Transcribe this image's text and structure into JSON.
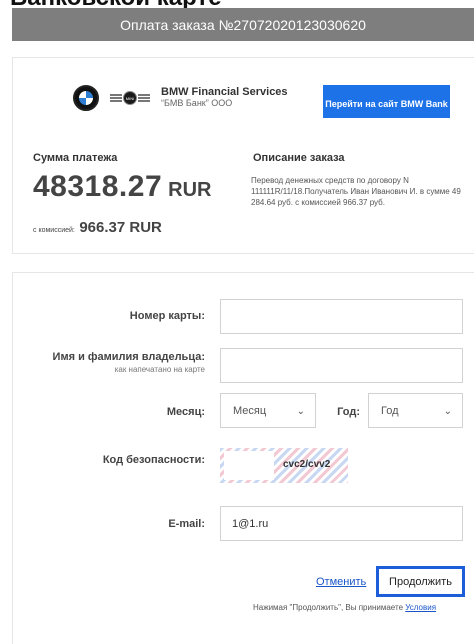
{
  "page": {
    "heading": "Банковской карте"
  },
  "order": {
    "title": "Оплата заказа №27072020123030620"
  },
  "merchant": {
    "logos": {
      "bmw": "bmw-logo",
      "mini": "mini-logo",
      "mini_text": "MINI"
    },
    "name": "BMW Financial Services",
    "subtitle": "“БМВ Банк” ООО",
    "site_button": "Перейти на сайт BMW Bank"
  },
  "payment": {
    "sum_label": "Сумма платежа",
    "amount": "48318.27",
    "currency": "RUR",
    "commission_label": "с комиссией:",
    "commission_value": "966.37 RUR"
  },
  "description": {
    "label": "Описание заказа",
    "text": "Перевод денежных средств по договору N 111111R/11/18.Получатель Иван Иванович И. в сумме 49 284.64 руб. с комиссией 966.37 руб."
  },
  "form": {
    "card_number_label": "Номер карты:",
    "card_number_value": "",
    "holder_label": "Имя и фамилия владельца:",
    "holder_hint": "как напечатано на карте",
    "holder_value": "",
    "month_label": "Месяц:",
    "month_value": "Месяц",
    "year_label": "Год:",
    "year_value": "Год",
    "cvc_label": "Код безопасности:",
    "cvc_hint": "cvc2/cvv2",
    "email_label": "E-mail:",
    "email_value": "1@1.ru"
  },
  "actions": {
    "cancel": "Отменить",
    "continue": "Продолжить",
    "terms_text": "Нажимая \"Продолжить\", Вы принимаете",
    "terms_link": "Условия"
  },
  "colors": {
    "accent": "#1e72e8",
    "header_bar": "#7e7e7e",
    "link": "#1a56c9"
  }
}
